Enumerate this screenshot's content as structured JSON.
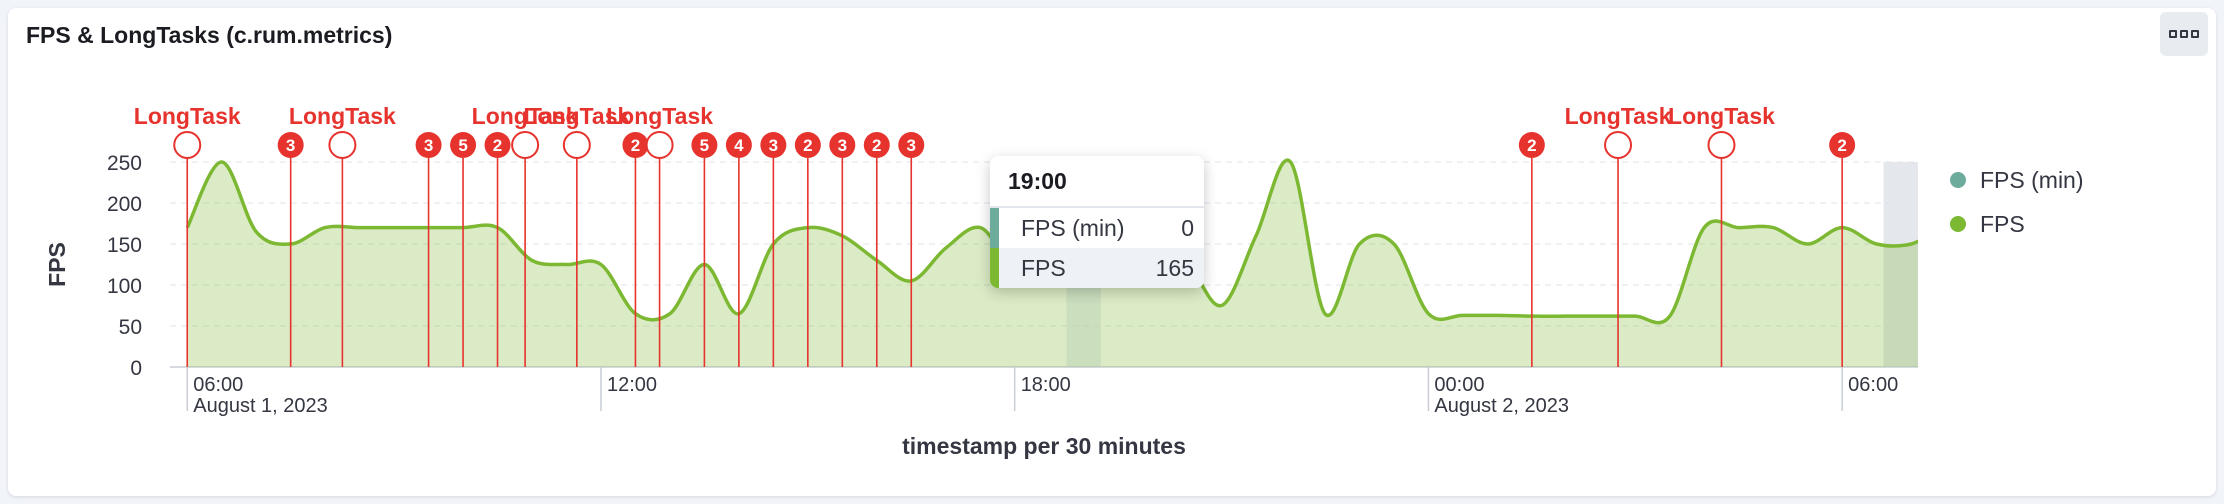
{
  "panel": {
    "title": "FPS & LongTasks (c.rum.metrics)"
  },
  "legend": {
    "items": [
      {
        "label": "FPS (min)",
        "color": "#6dab9c"
      },
      {
        "label": "FPS",
        "color": "#7cb832"
      }
    ]
  },
  "tooltip": {
    "header": "19:00",
    "rows": [
      {
        "label": "FPS (min)",
        "value": "0",
        "color": "#6dab9c"
      },
      {
        "label": "FPS",
        "value": "165",
        "color": "#7cb832"
      }
    ]
  },
  "chart_data": {
    "type": "area",
    "title": "FPS & LongTasks (c.rum.metrics)",
    "xlabel": "timestamp per 30 minutes",
    "ylabel": "FPS",
    "ylim": [
      0,
      250
    ],
    "yticks": [
      0,
      50,
      100,
      150,
      200,
      250
    ],
    "xlim": [
      5.75,
      31.1
    ],
    "xticks": [
      {
        "x": 6,
        "label": "06:00",
        "sublabel": "August 1, 2023"
      },
      {
        "x": 12,
        "label": "12:00",
        "sublabel": ""
      },
      {
        "x": 18,
        "label": "18:00",
        "sublabel": ""
      },
      {
        "x": 24,
        "label": "00:00",
        "sublabel": "August 2, 2023"
      },
      {
        "x": 30,
        "label": "06:00",
        "sublabel": ""
      }
    ],
    "grid": true,
    "legend_position": "right",
    "series": [
      {
        "name": "FPS",
        "color": "#7cb832",
        "points": [
          [
            6.0,
            170
          ],
          [
            6.5,
            250
          ],
          [
            7.0,
            165
          ],
          [
            7.5,
            150
          ],
          [
            8.0,
            170
          ],
          [
            8.5,
            170
          ],
          [
            9.0,
            170
          ],
          [
            9.5,
            170
          ],
          [
            10.0,
            170
          ],
          [
            10.5,
            170
          ],
          [
            11.0,
            130
          ],
          [
            11.5,
            125
          ],
          [
            12.0,
            125
          ],
          [
            12.5,
            65
          ],
          [
            13.0,
            65
          ],
          [
            13.5,
            125
          ],
          [
            14.0,
            65
          ],
          [
            14.5,
            150
          ],
          [
            15.0,
            170
          ],
          [
            15.5,
            160
          ],
          [
            16.0,
            130
          ],
          [
            16.5,
            105
          ],
          [
            17.0,
            145
          ],
          [
            17.5,
            170
          ],
          [
            18.0,
            125
          ],
          [
            18.5,
            165
          ],
          [
            19.0,
            165
          ],
          [
            19.5,
            165
          ],
          [
            20.0,
            165
          ],
          [
            20.5,
            130
          ],
          [
            21.0,
            75
          ],
          [
            21.5,
            160
          ],
          [
            22.0,
            250
          ],
          [
            22.5,
            65
          ],
          [
            23.0,
            150
          ],
          [
            23.5,
            150
          ],
          [
            24.0,
            65
          ],
          [
            24.5,
            63
          ],
          [
            25.0,
            63
          ],
          [
            25.5,
            62
          ],
          [
            26.0,
            62
          ],
          [
            26.5,
            62
          ],
          [
            27.0,
            62
          ],
          [
            27.5,
            62
          ],
          [
            28.0,
            170
          ],
          [
            28.5,
            170
          ],
          [
            29.0,
            170
          ],
          [
            29.5,
            150
          ],
          [
            30.0,
            170
          ],
          [
            30.5,
            150
          ],
          [
            31.0,
            150
          ],
          [
            31.5,
            170
          ],
          [
            32.0,
            170
          ]
        ]
      },
      {
        "name": "FPS (min)",
        "color": "#6dab9c",
        "points": [
          [
            19.0,
            0
          ]
        ]
      }
    ],
    "markers": [
      {
        "x": 6.0,
        "label": "LongTask",
        "count": ""
      },
      {
        "x": 7.5,
        "label": "",
        "count": "3"
      },
      {
        "x": 8.25,
        "label": "LongTask",
        "count": ""
      },
      {
        "x": 9.5,
        "label": "",
        "count": "3"
      },
      {
        "x": 10.0,
        "label": "",
        "count": "5"
      },
      {
        "x": 10.5,
        "label": "",
        "count": "2"
      },
      {
        "x": 10.9,
        "label": "LongTask",
        "count": ""
      },
      {
        "x": 11.65,
        "label": "LongTask",
        "count": ""
      },
      {
        "x": 12.5,
        "label": "",
        "count": "2"
      },
      {
        "x": 12.85,
        "label": "LongTask",
        "count": ""
      },
      {
        "x": 13.5,
        "label": "",
        "count": "5"
      },
      {
        "x": 14.0,
        "label": "",
        "count": "4"
      },
      {
        "x": 14.5,
        "label": "",
        "count": "3"
      },
      {
        "x": 15.0,
        "label": "",
        "count": "2"
      },
      {
        "x": 15.5,
        "label": "",
        "count": "3"
      },
      {
        "x": 16.0,
        "label": "",
        "count": "2"
      },
      {
        "x": 16.5,
        "label": "",
        "count": "3"
      },
      {
        "x": 25.5,
        "label": "",
        "count": "2"
      },
      {
        "x": 26.75,
        "label": "LongTask",
        "count": ""
      },
      {
        "x": 28.25,
        "label": "LongTask",
        "count": ""
      },
      {
        "x": 30.0,
        "label": "",
        "count": "2"
      }
    ]
  }
}
